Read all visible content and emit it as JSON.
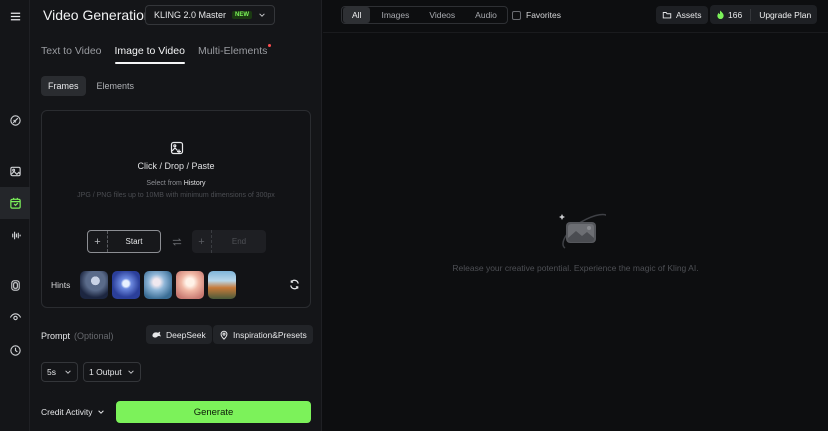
{
  "header": {
    "title": "Video Generation",
    "model": "KLING 2.0 Master",
    "model_badge": "NEW"
  },
  "mode_tabs": [
    "Text to Video",
    "Image to Video",
    "Multi-Elements"
  ],
  "active_mode_tab": "Image to Video",
  "sub_tabs": [
    "Frames",
    "Elements"
  ],
  "active_sub_tab": "Frames",
  "upload": {
    "main_text": "Click / Drop / Paste",
    "select_prefix": "Select from",
    "select_link": "History",
    "hint": "JPG / PNG files up to 10MB with minimum dimensions of 300px",
    "start_label": "Start",
    "end_label": "End",
    "hints_label": "Hints"
  },
  "prompt": {
    "label": "Prompt",
    "optional": "(Optional)",
    "deepseek": "DeepSeek",
    "inspiration": "Inspiration&Presets"
  },
  "settings": {
    "duration": "5s",
    "outputs": "1 Output"
  },
  "footer": {
    "credit_activity": "Credit Activity",
    "generate": "Generate"
  },
  "toolbar": {
    "filters": [
      "All",
      "Images",
      "Videos",
      "Audio"
    ],
    "active_filter": "All",
    "favorites": "Favorites",
    "assets": "Assets",
    "credits": "166",
    "upgrade": "Upgrade Plan"
  },
  "empty_state": "Release your creative potential. Experience the magic of Kling AI.",
  "colors": {
    "accent": "#7cf25a",
    "panel": "#141518",
    "background": "#0d0e10"
  }
}
